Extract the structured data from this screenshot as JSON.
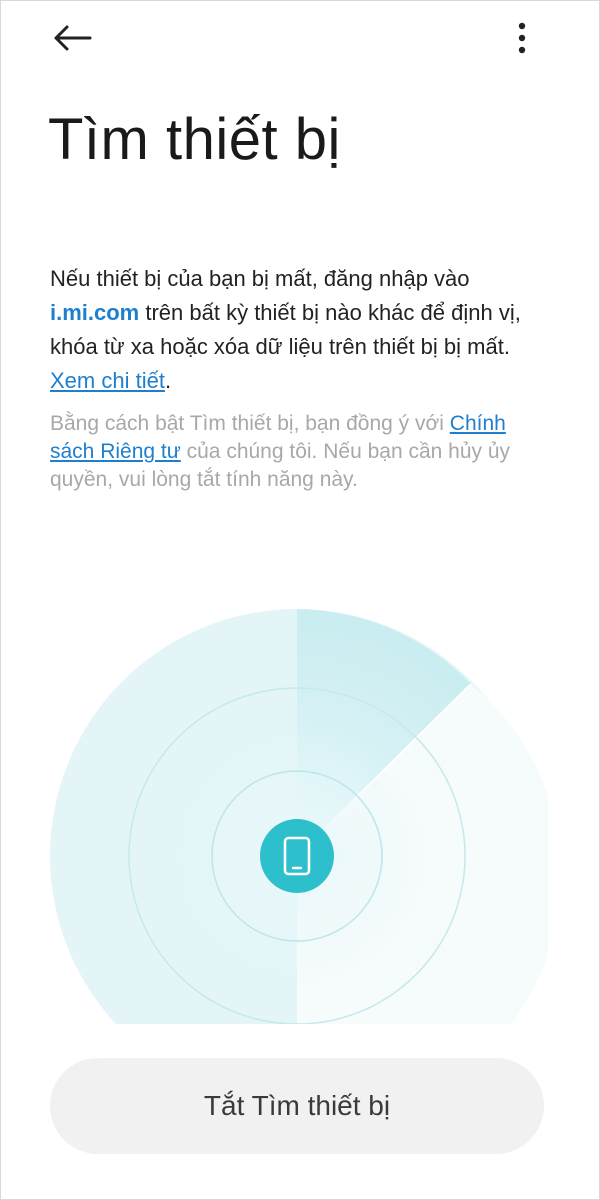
{
  "header": {
    "back_icon": "arrow-left-icon",
    "more_icon": "vertical-dots-icon"
  },
  "page": {
    "title": "Tìm thiết bị"
  },
  "description": {
    "part1": "Nếu thiết bị của bạn bị mất, đăng nhập vào ",
    "site": "i.mi.com",
    "part2": " trên bất kỳ thiết bị nào khác để định vị, khóa từ xa hoặc xóa dữ liệu trên thiết bị bị mất. ",
    "details_link": "Xem chi tiết",
    "end": "."
  },
  "note": {
    "part1": "Bằng cách bật Tìm thiết bị, bạn đồng ý với ",
    "privacy_link": "Chính sách Riêng tư",
    "part2": " của chúng tôi. Nếu bạn cần hủy ủy quyền, vui lòng tắt tính năng này."
  },
  "radar": {
    "icon": "smartphone-icon",
    "accent_color": "#2ebfcc"
  },
  "actions": {
    "turn_off_label": "Tắt Tìm thiết bị"
  }
}
